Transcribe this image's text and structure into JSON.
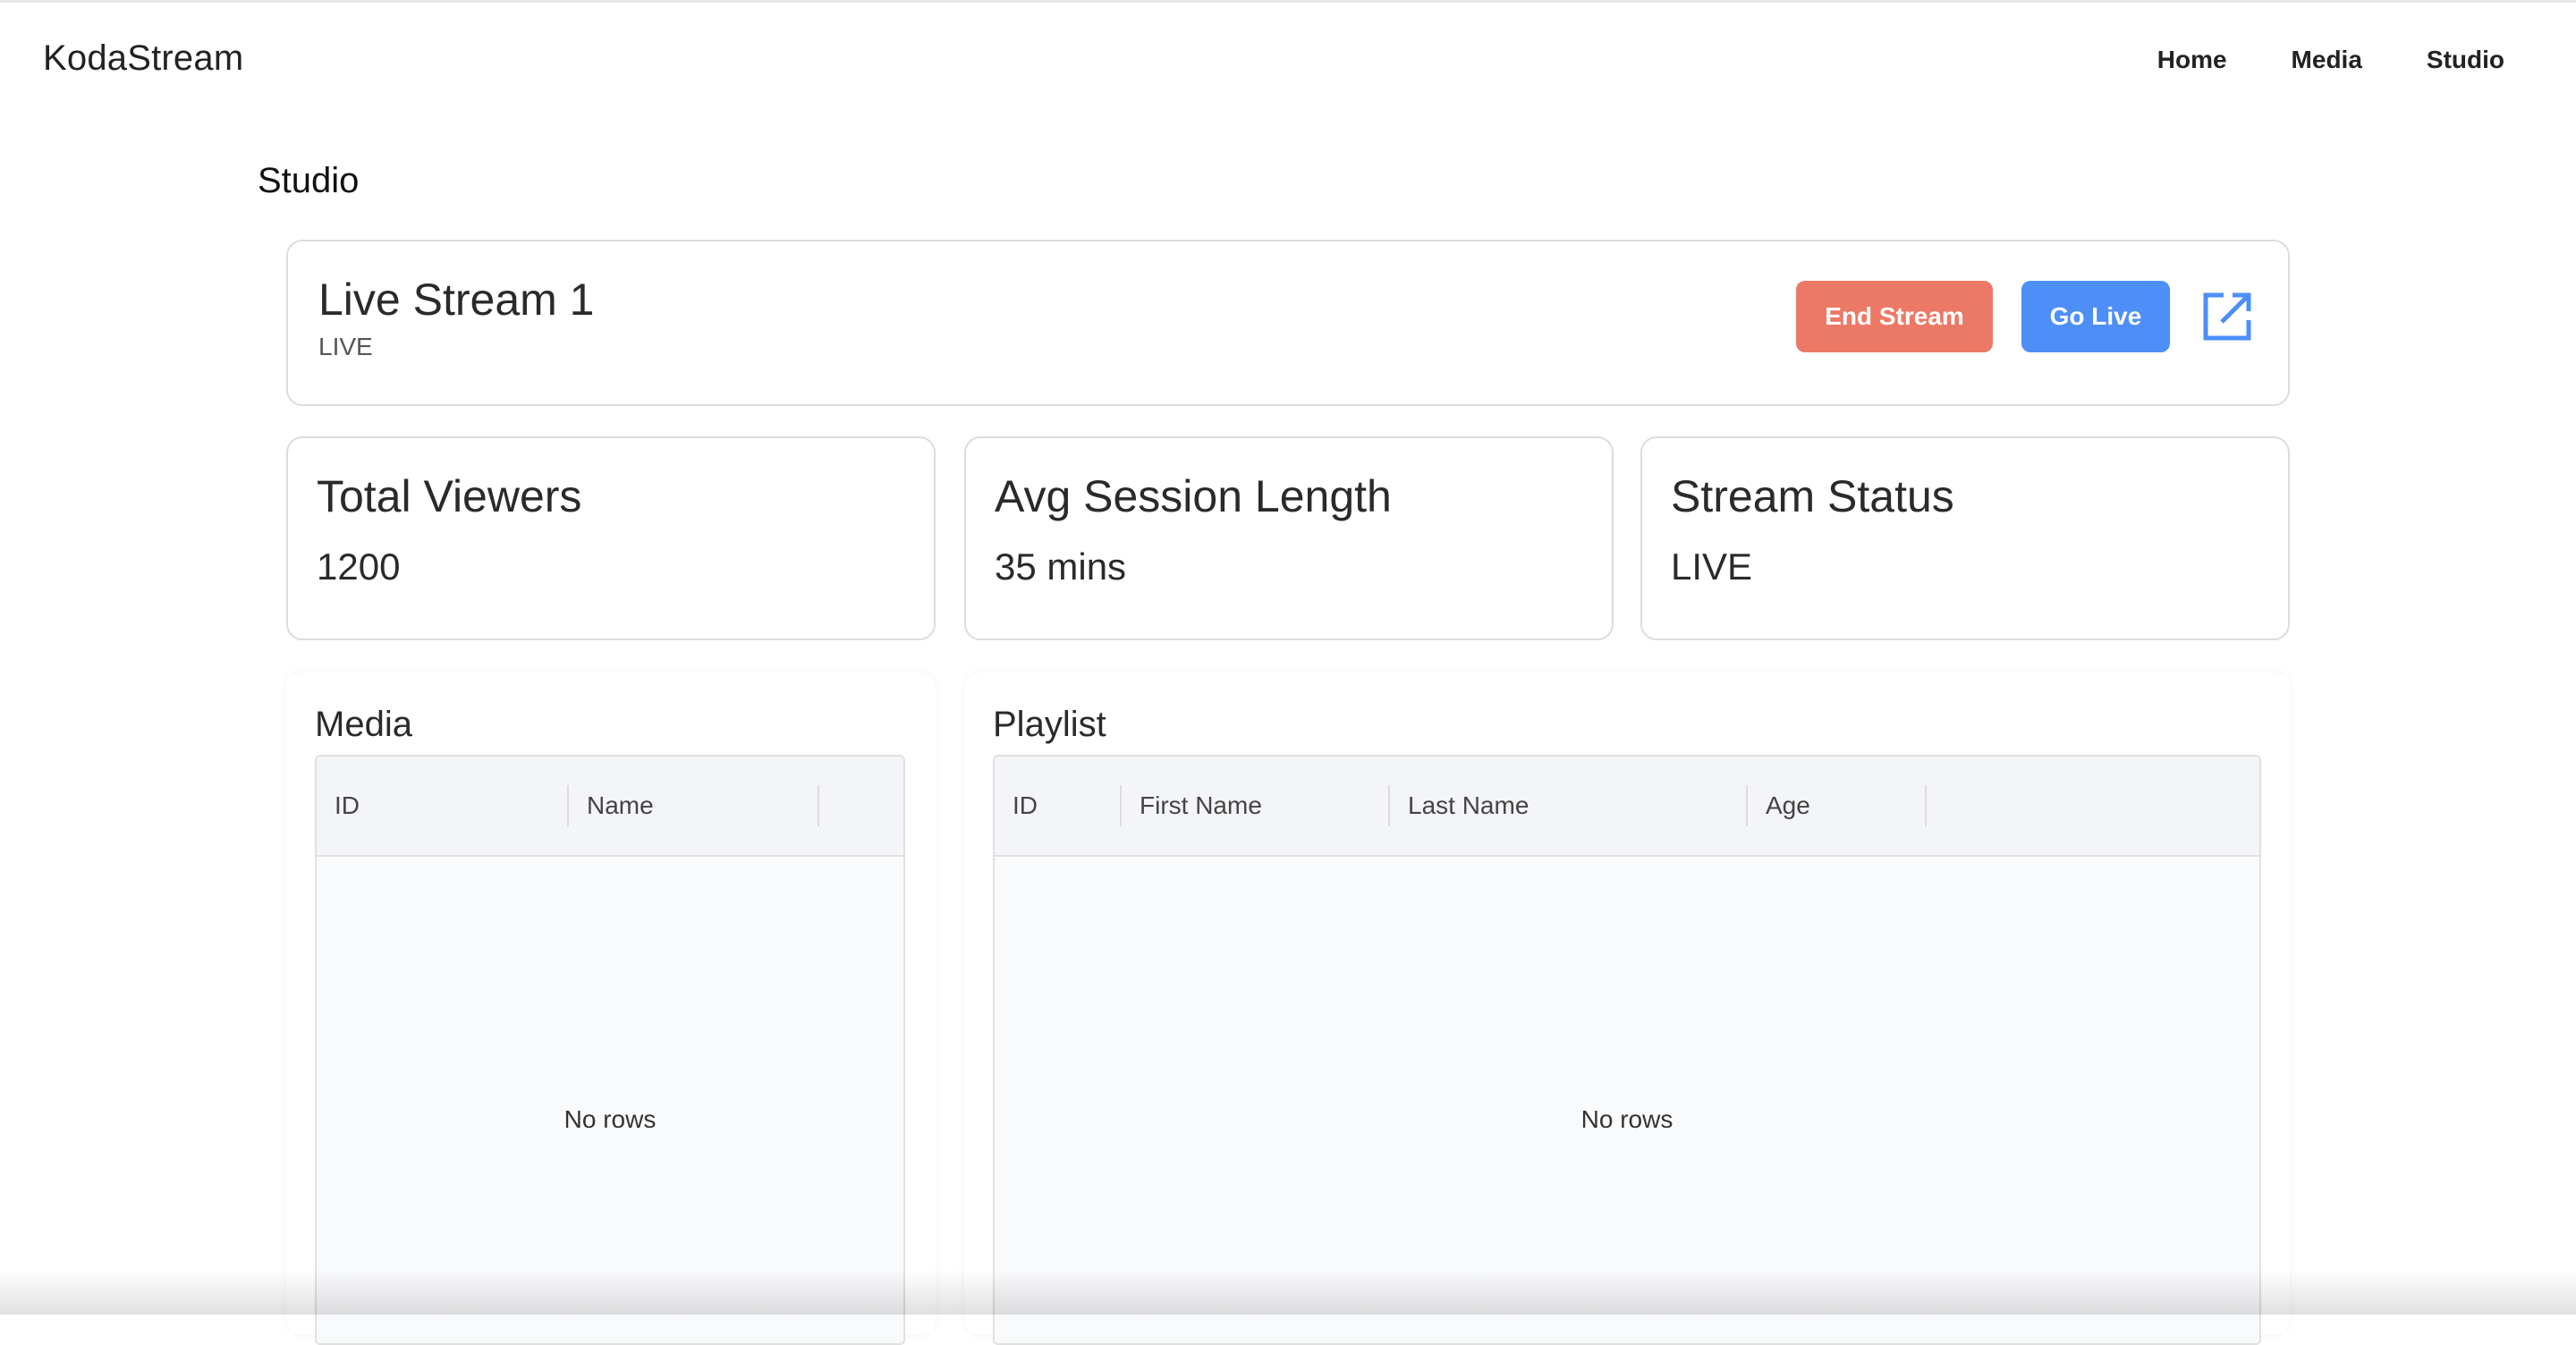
{
  "app": {
    "brand": "KodaStream"
  },
  "nav": {
    "items": [
      {
        "label": "Home"
      },
      {
        "label": "Media"
      },
      {
        "label": "Studio"
      }
    ]
  },
  "page": {
    "title": "Studio"
  },
  "stream": {
    "name": "Live Stream 1",
    "status": "LIVE",
    "end_label": "End Stream",
    "go_live_label": "Go Live",
    "open_icon": "external-link-icon"
  },
  "stats": [
    {
      "title": "Total Viewers",
      "value": "1200"
    },
    {
      "title": "Avg Session Length",
      "value": "35 mins"
    },
    {
      "title": "Stream Status",
      "value": "LIVE"
    }
  ],
  "media": {
    "title": "Media",
    "columns": [
      "ID",
      "Name"
    ],
    "empty_text": "No rows"
  },
  "playlist": {
    "title": "Playlist",
    "columns": [
      "ID",
      "First Name",
      "Last Name",
      "Age"
    ],
    "empty_text": "No rows"
  },
  "colors": {
    "end_button": "#ec7866",
    "go_live_button": "#4d8ff7",
    "icon_accent": "#4d8ff7"
  }
}
